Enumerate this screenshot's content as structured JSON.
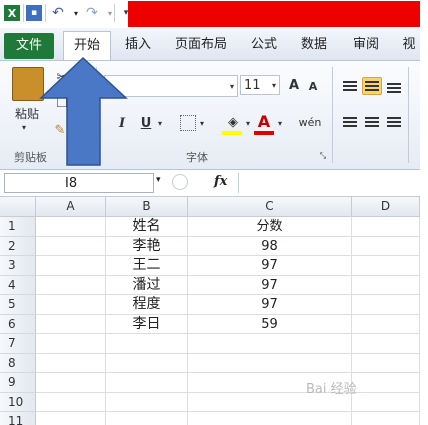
{
  "quick_access": {
    "app_logo": "X",
    "save_icon": "save-icon",
    "undo_icon": "↶",
    "redo_icon": "↷",
    "dropdown": "▾"
  },
  "tabs": [
    {
      "label": "文件"
    },
    {
      "label": "开始"
    },
    {
      "label": "插入"
    },
    {
      "label": "页面布局"
    },
    {
      "label": "公式"
    },
    {
      "label": "数据"
    },
    {
      "label": "审阅"
    },
    {
      "label": "视"
    }
  ],
  "ribbon": {
    "clipboard": {
      "paste_label": "粘贴",
      "group_label": "剪贴板"
    },
    "font": {
      "font_name": "",
      "font_size": "11",
      "grow": "A",
      "shrink": "A",
      "italic": "I",
      "underline": "U",
      "font_color_glyph": "A",
      "phonetic": "wén",
      "group_label": "字体"
    },
    "colors": {
      "fill_highlight": "#ffff00",
      "font_color": "#e00000"
    }
  },
  "formula_bar": {
    "name_box": "I8",
    "fx": "fx",
    "formula": ""
  },
  "sheet": {
    "columns": [
      "A",
      "B",
      "C",
      "D"
    ],
    "rows": [
      "1",
      "2",
      "3",
      "4",
      "5",
      "6",
      "7",
      "8",
      "9",
      "10",
      "11"
    ],
    "data": [
      [
        "",
        "姓名",
        "分数",
        ""
      ],
      [
        "",
        "李艳",
        "98",
        ""
      ],
      [
        "",
        "王二",
        "97",
        ""
      ],
      [
        "",
        "潘过",
        "97",
        ""
      ],
      [
        "",
        "程度",
        "97",
        ""
      ],
      [
        "",
        "李日",
        "59",
        ""
      ]
    ]
  },
  "overlay": {
    "arrow_color": "#4472c4"
  },
  "watermark": "Bai 经验"
}
